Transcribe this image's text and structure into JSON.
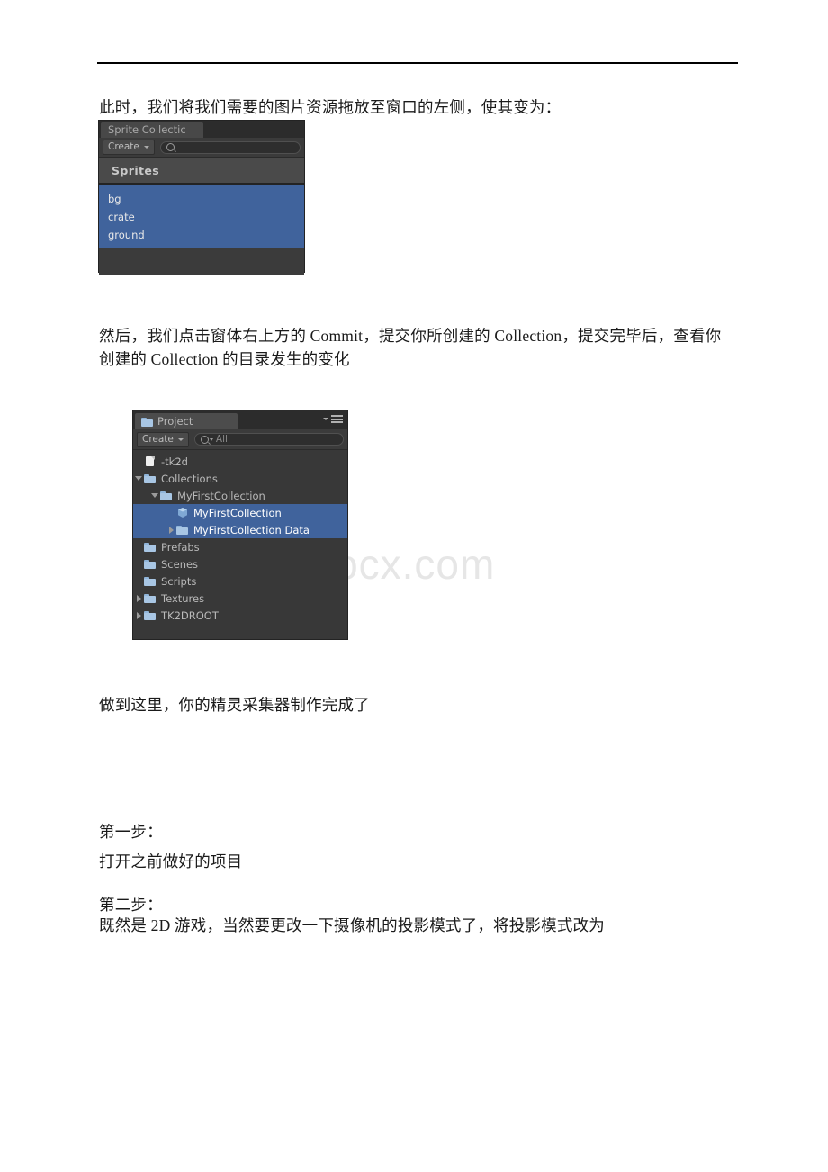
{
  "document": {
    "watermark": "www.bdocx.com",
    "paragraphs": [
      {
        "id": "p1",
        "text": "此时，我们将我们需要的图片资源拖放至窗口的左侧，使其变为："
      },
      {
        "id": "p2",
        "text": "然后，我们点击窗体右上方的 Commit，提交你所创建的 Collection，提交完毕后，查看你创建的 Collection 的目录发生的变化"
      },
      {
        "id": "p3",
        "text": "做到这里，你的精灵采集器制作完成了"
      },
      {
        "id": "p4",
        "text": "第一步："
      },
      {
        "id": "p5",
        "text": "打开之前做好的项目"
      },
      {
        "id": "p6",
        "text": "第二步："
      },
      {
        "id": "p7",
        "text": "既然是 2D 游戏，当然要更改一下摄像机的投影模式了，将投影模式改为"
      }
    ]
  },
  "sprite_collection_window": {
    "tab_label": "Sprite Collectic",
    "create_button": "Create",
    "search_placeholder": "",
    "search_value": "",
    "section_header": "Sprites",
    "sprites": [
      "bg",
      "crate",
      "ground"
    ],
    "selection_color": "#40639c"
  },
  "project_window": {
    "tab_label": "Project",
    "create_button": "Create",
    "search_value": "All",
    "tree": [
      {
        "label": "-tk2d",
        "icon": "file-icon",
        "indent": 0,
        "twisty": "none",
        "selected": false
      },
      {
        "label": "Collections",
        "icon": "folder-icon",
        "indent": 0,
        "twisty": "down",
        "selected": false
      },
      {
        "label": "MyFirstCollection",
        "icon": "folder-icon",
        "indent": 1,
        "twisty": "down",
        "selected": false
      },
      {
        "label": "MyFirstCollection",
        "icon": "prefab-cube-icon",
        "indent": 2,
        "twisty": "none",
        "selected": true
      },
      {
        "label": "MyFirstCollection Data",
        "icon": "folder-icon",
        "indent": 2,
        "twisty": "right",
        "selected": true
      },
      {
        "label": "Prefabs",
        "icon": "folder-icon",
        "indent": 0,
        "twisty": "none",
        "selected": false
      },
      {
        "label": "Scenes",
        "icon": "folder-icon",
        "indent": 0,
        "twisty": "none",
        "selected": false
      },
      {
        "label": "Scripts",
        "icon": "folder-icon",
        "indent": 0,
        "twisty": "none",
        "selected": false
      },
      {
        "label": "Textures",
        "icon": "folder-icon",
        "indent": 0,
        "twisty": "right",
        "selected": false
      },
      {
        "label": "TK2DROOT",
        "icon": "folder-icon",
        "indent": 0,
        "twisty": "right",
        "selected": false
      }
    ],
    "selection_color": "#40639c"
  }
}
